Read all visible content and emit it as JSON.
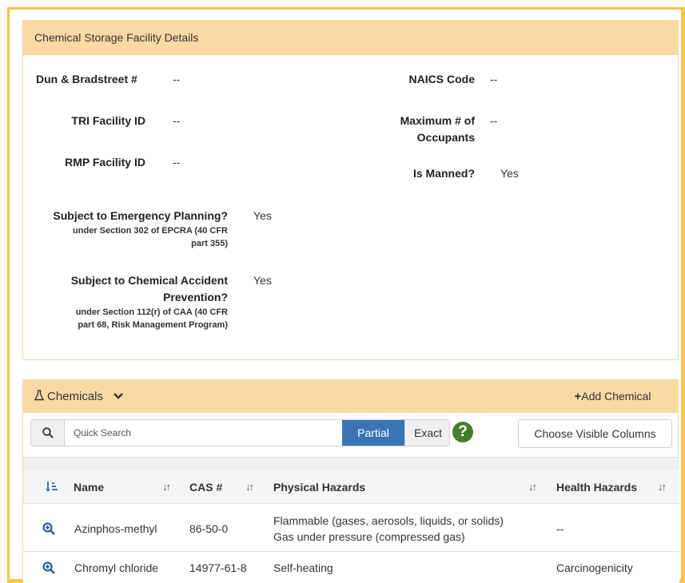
{
  "facility": {
    "header": "Chemical Storage Facility Details",
    "dun_label": "Dun & Bradstreet #",
    "dun_value": "--",
    "naics_label": "NAICS Code",
    "naics_value": "--",
    "tri_label": "TRI Facility ID",
    "tri_value": "--",
    "max_occ_label_1": "Maximum # of",
    "max_occ_label_2": "Occupants",
    "max_occ_value": "--",
    "rmp_label": "RMP Facility ID",
    "rmp_value": "--",
    "manned_label": "Is Manned?",
    "manned_value": "Yes",
    "emergency_label": "Subject to Emergency Planning?",
    "emergency_sub_1": "under Section 302 of EPCRA (40 CFR",
    "emergency_sub_2": "part 355)",
    "emergency_value": "Yes",
    "accident_label_1": "Subject to Chemical Accident",
    "accident_label_2": "Prevention?",
    "accident_sub_1": "under Section 112(r) of CAA (40 CFR",
    "accident_sub_2": "part 68, Risk Management Program)",
    "accident_value": "Yes"
  },
  "chemicals": {
    "title": "Chemicals",
    "add_label": "Add Chemical",
    "search_placeholder": "Quick Search",
    "partial_label": "Partial",
    "exact_label": "Exact",
    "help_glyph": "?",
    "columns_button": "Choose Visible Columns",
    "columns": [
      "Name",
      "CAS #",
      "Physical Hazards",
      "Health Hazards"
    ],
    "rows": [
      {
        "name": "Azinphos-methyl",
        "cas": "86-50-0",
        "physical_1": "Flammable (gases, aerosols, liquids, or solids)",
        "physical_2": "Gas under pressure (compressed gas)",
        "health": "--"
      },
      {
        "name": "Chromyl chloride",
        "cas": "14977-61-8",
        "physical_1": "Self-heating",
        "physical_2": "",
        "health": "Carcinogenicity"
      }
    ]
  },
  "colors": {
    "frame": "#f9c548",
    "panel_header": "#fbd9a2",
    "partial_active": "#3b74b6",
    "help_icon": "#497d2e",
    "zoom_icon": "#2a5f9e"
  }
}
